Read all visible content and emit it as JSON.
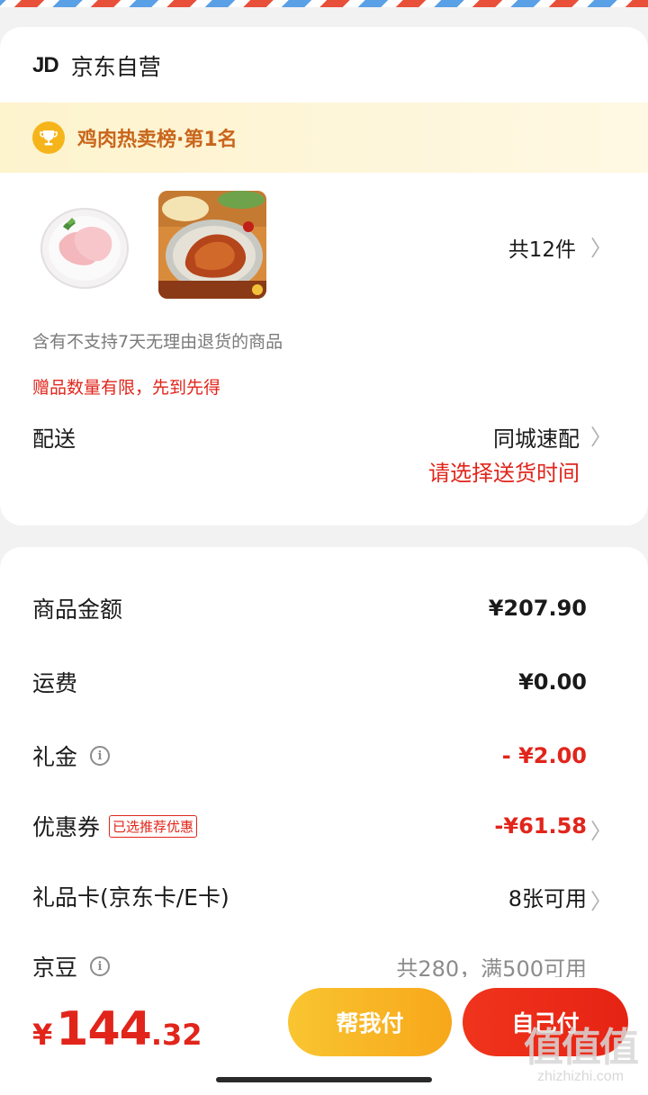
{
  "shop": {
    "logo": "JD",
    "name": "京东自营"
  },
  "rank_banner": {
    "text": "鸡肉热卖榜·第1名"
  },
  "items": {
    "thumbnails": [
      {
        "name": "raw chicken breast"
      },
      {
        "name": "roast chicken"
      }
    ],
    "count_text": "共12件"
  },
  "notes": {
    "return_policy": "含有不支持7天无理由退货的商品",
    "gift_limit": "赠品数量有限，先到先得"
  },
  "delivery": {
    "label": "配送",
    "method": "同城速配",
    "time_prompt": "请选择送货时间"
  },
  "summary": {
    "rows": [
      {
        "label": "商品金额",
        "value": "¥207.90"
      },
      {
        "label": "运费",
        "value": "¥0.00"
      },
      {
        "label": "礼金",
        "value": "- ¥2.00"
      },
      {
        "label": "优惠券",
        "tag": "已选推荐优惠",
        "value": "-¥61.58"
      },
      {
        "label": "礼品卡(京东卡/E卡)",
        "value": "8张可用"
      },
      {
        "label": "京豆",
        "value": "共280，满500可用"
      }
    ]
  },
  "footer": {
    "currency": "¥",
    "total_int": "144",
    "total_dec": ".32",
    "help_pay_label": "帮我付",
    "self_pay_label": "自己付"
  },
  "watermark": {
    "mark": "值值值",
    "url": "zhizhizhi.com"
  },
  "colors": {
    "accent_red": "#e1251b",
    "banner_text": "#c9661c",
    "help_btn": "#f7a71a",
    "self_btn": "#e62314"
  }
}
